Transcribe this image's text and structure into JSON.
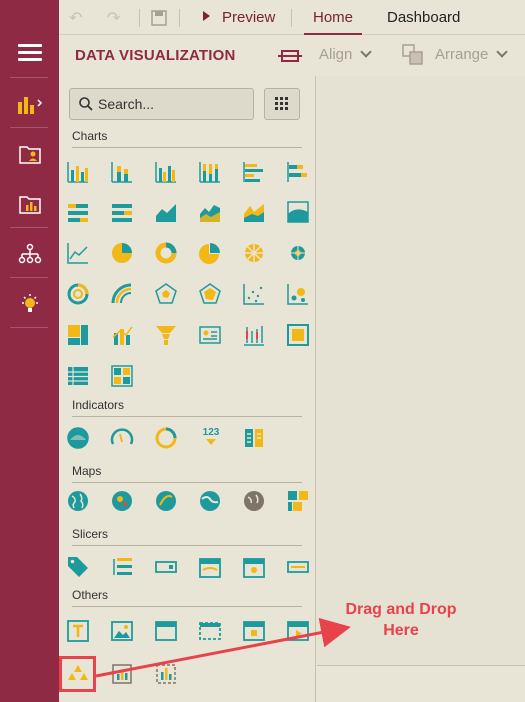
{
  "toolbar": {
    "preview_label": "Preview",
    "tabs": [
      "Home",
      "Dashboard"
    ]
  },
  "subbar": {
    "title": "DATA VISUALIZATION",
    "align_label": "Align",
    "arrange_label": "Arrange"
  },
  "search": {
    "placeholder": "Search..."
  },
  "sections": {
    "charts": "Charts",
    "indicators": "Indicators",
    "maps": "Maps",
    "slicers": "Slicers",
    "others": "Others"
  },
  "annotation": {
    "line1": "Drag and Drop",
    "line2": "Here"
  },
  "colors": {
    "brand": "#8e2a43",
    "teal": "#1f9a9c",
    "gold": "#f2b818",
    "highlight": "#e8424b"
  },
  "indicator_text": "123"
}
